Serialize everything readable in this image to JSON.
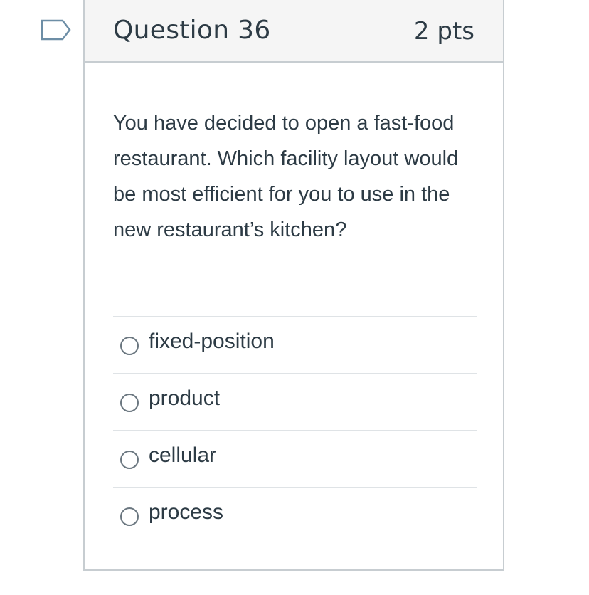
{
  "colors": {
    "text": "#2d3b45",
    "header_bg": "#f5f5f5",
    "border": "#c7cdd1",
    "flag_stroke": "#6d8ea6"
  },
  "flag": {
    "icon": "bookmark-flag-icon"
  },
  "question": {
    "title": "Question 36",
    "points": "2 pts",
    "text": "You have decided to open a fast-food restaurant. Which facility layout would be most efficient for you to use in the new restaurant’s kitchen?"
  },
  "answers": [
    {
      "label": "fixed-position",
      "selected": false
    },
    {
      "label": "product",
      "selected": false
    },
    {
      "label": "cellular",
      "selected": false
    },
    {
      "label": "process",
      "selected": false
    }
  ]
}
